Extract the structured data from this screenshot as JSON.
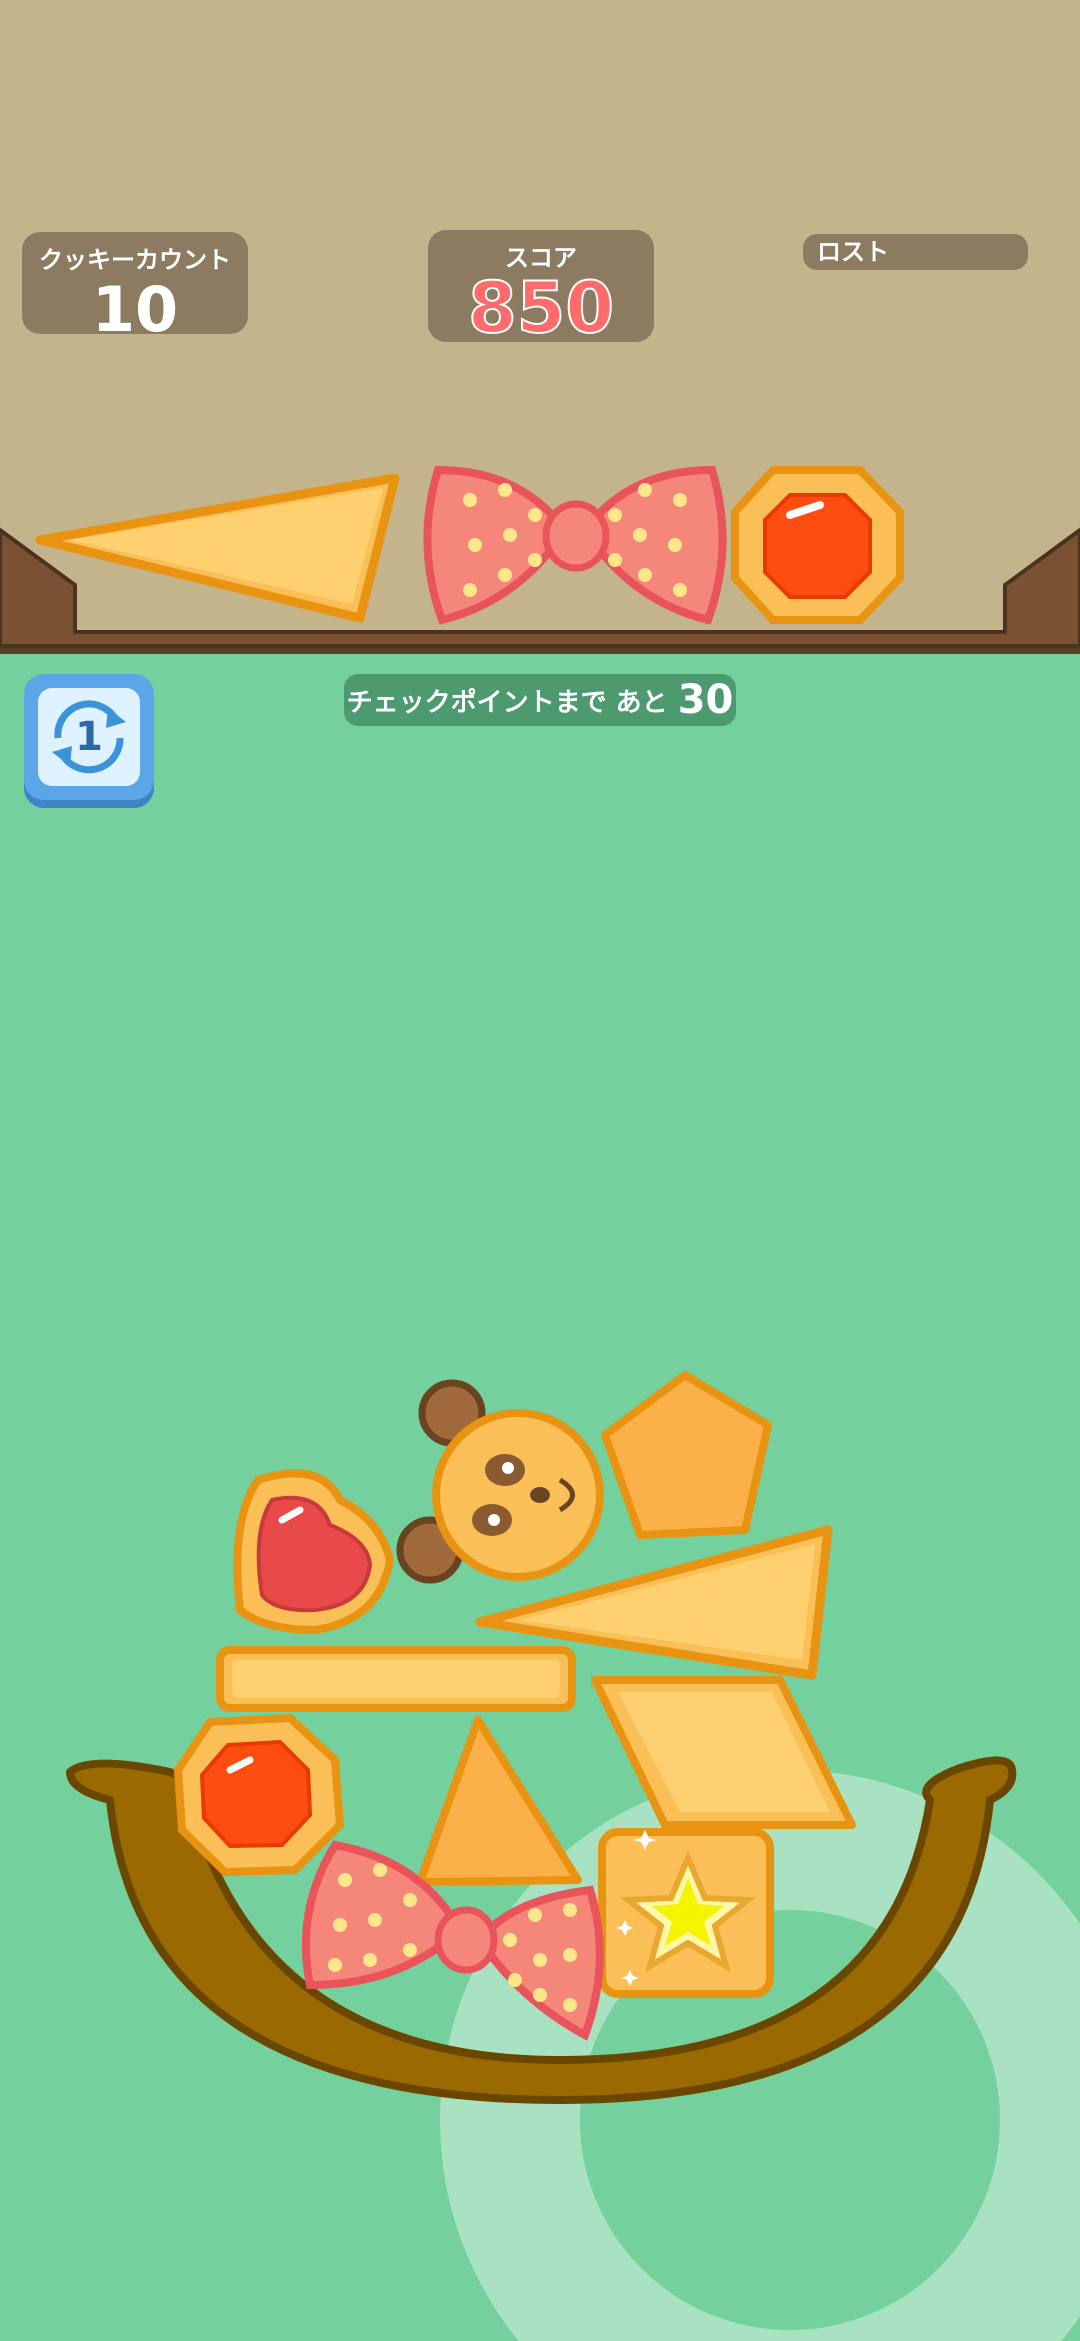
{
  "hud": {
    "cookie_count_label": "クッキーカウント",
    "cookie_count_value": "10",
    "score_label": "スコア",
    "score_value": "850",
    "lost_label": "ロスト"
  },
  "checkpoint": {
    "text": "チェックポイントまで あと",
    "remaining": "30"
  },
  "rotate_button": {
    "count": "1"
  },
  "colors": {
    "background": "#74d09c",
    "top_area": "#c4b48b",
    "hud_box": "#8c7b60",
    "cookie": "#fbbf58",
    "cookie_outline": "#e89412",
    "jam_red": "#ff4d12",
    "bow_pink": "#f4877a",
    "tray_brown": "#7a5200"
  },
  "next_cookies": [
    "triangle-cookie",
    "bow-cookie",
    "octagon-jam-cookie"
  ],
  "stacked_cookies": [
    "panda-cookie",
    "pentagon-cookie",
    "heart-jam-cookie",
    "triangle-cookie",
    "bar-cookie",
    "diamond-cookie",
    "octagon-jam-cookie",
    "small-triangle-cookie",
    "star-square-cookie",
    "bow-cookie"
  ]
}
